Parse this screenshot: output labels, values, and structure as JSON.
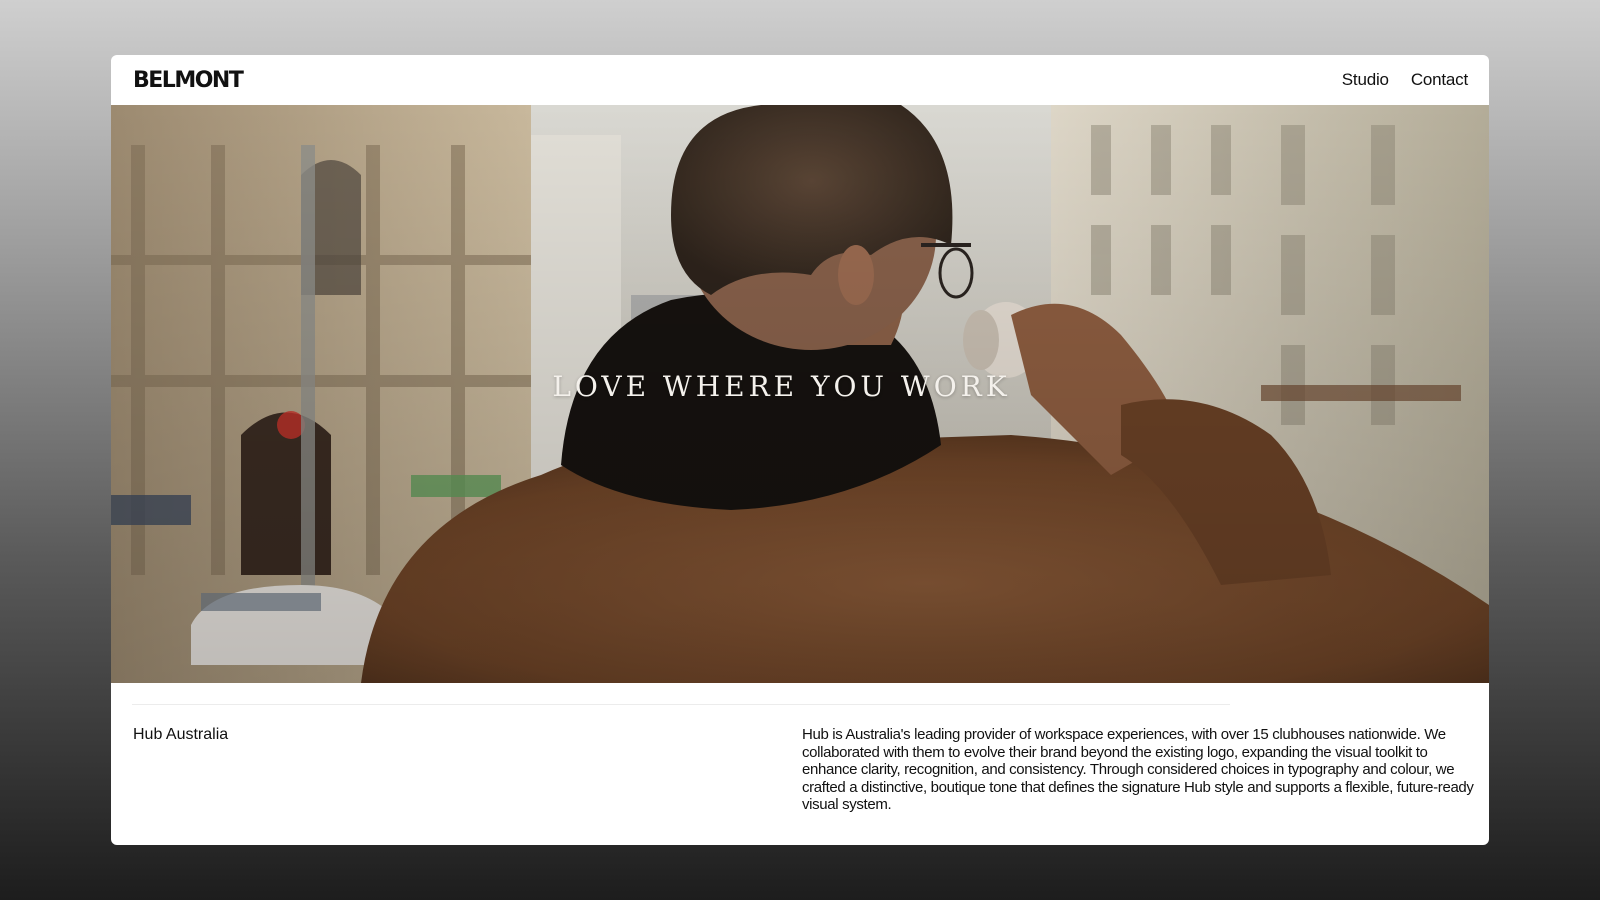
{
  "header": {
    "logo_text": "BELMONT",
    "nav": [
      {
        "label": "Studio"
      },
      {
        "label": "Contact"
      }
    ]
  },
  "hero": {
    "tagline": "LOVE WHERE YOU WORK"
  },
  "project": {
    "client": "Hub Australia",
    "description": "Hub is Australia's leading provider of workspace experiences, with over 15 clubhouses nationwide. We collaborated with them to evolve their brand beyond the existing logo, expanding the visual toolkit to enhance clarity, recognition, and consistency. Through considered choices in typography and colour, we crafted a distinctive, boutique tone that defines the signature Hub style and supports a flexible, future-ready visual system."
  }
}
